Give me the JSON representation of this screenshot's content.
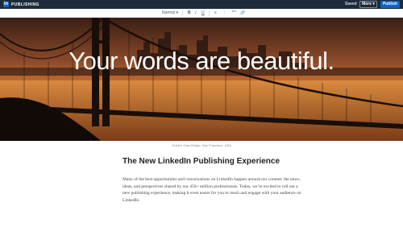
{
  "header": {
    "logo_mark": "in",
    "app_name": "PUBLISHING",
    "saved_status": "Saved",
    "more_label": "More",
    "publish_label": "Publish"
  },
  "toolbar": {
    "style_select": "Normal",
    "bold": "B",
    "italic": "I",
    "underline": "U",
    "quote": "“”",
    "link": "🔗"
  },
  "hero": {
    "headline": "Your words are beautiful.",
    "caption": "Golden Gate Bridge, San Francisco, USA"
  },
  "article": {
    "title": "The New LinkedIn Publishing Experience",
    "body": "Many of the best opportunities and conversations on LinkedIn happen around our content: the news, ideas, and perspectives shared by our 450+ million professionals. Today, we’re excited to roll out a new publishing experience, making it even easier for you to reach and engage with your audience on LinkedIn."
  },
  "colors": {
    "topbar": "#1d2b3a",
    "brand_blue": "#0a66c2",
    "sky_top": "#5a3020",
    "sky_glow": "#e08a3c"
  }
}
